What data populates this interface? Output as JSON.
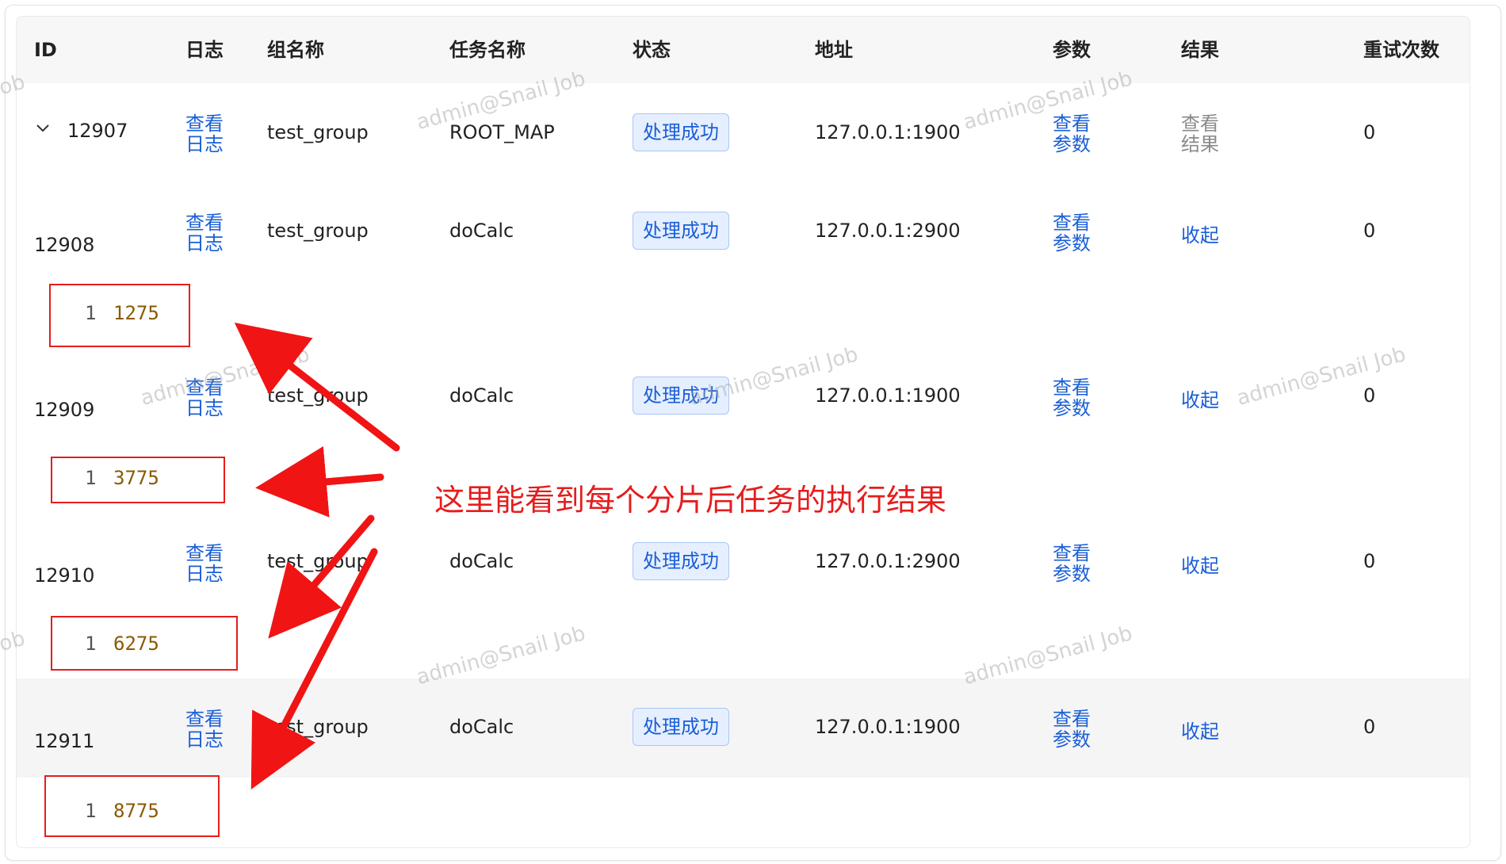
{
  "headers": {
    "id": "ID",
    "log": "日志",
    "group": "组名称",
    "task": "任务名称",
    "status": "状态",
    "address": "地址",
    "params": "参数",
    "result": "结果",
    "retries": "重试次数"
  },
  "rows": [
    {
      "id": "12907",
      "log": "查看日志",
      "group": "test_group",
      "task": "ROOT_MAP",
      "status": "处理成功",
      "address": "127.0.0.1:1900",
      "params": "查看参数",
      "result": "查看结果",
      "retries": "0",
      "expanded": true,
      "icon": "chevron-down-icon"
    },
    {
      "id": "12908",
      "log": "查看日志",
      "group": "test_group",
      "task": "doCalc",
      "status": "处理成功",
      "address": "127.0.0.1:2900",
      "params": "查看参数",
      "result": "收起",
      "retries": "0",
      "sub": {
        "line": "1",
        "value": "1275"
      }
    },
    {
      "id": "12909",
      "log": "查看日志",
      "group": "test_group",
      "task": "doCalc",
      "status": "处理成功",
      "address": "127.0.0.1:1900",
      "params": "查看参数",
      "result": "收起",
      "retries": "0",
      "sub": {
        "line": "1",
        "value": "3775"
      }
    },
    {
      "id": "12910",
      "log": "查看日志",
      "group": "test_group",
      "task": "doCalc",
      "status": "处理成功",
      "address": "127.0.0.1:2900",
      "params": "查看参数",
      "result": "收起",
      "retries": "0",
      "sub": {
        "line": "1",
        "value": "6275"
      }
    },
    {
      "id": "12911",
      "log": "查看日志",
      "group": "test_group",
      "task": "doCalc",
      "status": "处理成功",
      "address": "127.0.0.1:1900",
      "params": "查看参数",
      "result": "收起",
      "retries": "0",
      "sub": {
        "line": "1",
        "value": "8775"
      }
    }
  ],
  "watermark": "admin@Snail Job",
  "watermark_partial": "Job",
  "annotation": "这里能看到每个分片后任务的执行结果",
  "colors": {
    "link": "#1a5fd6",
    "annotation": "#e51d1d",
    "result_value": "#8a5a00",
    "badge_bg": "#e6efff"
  }
}
